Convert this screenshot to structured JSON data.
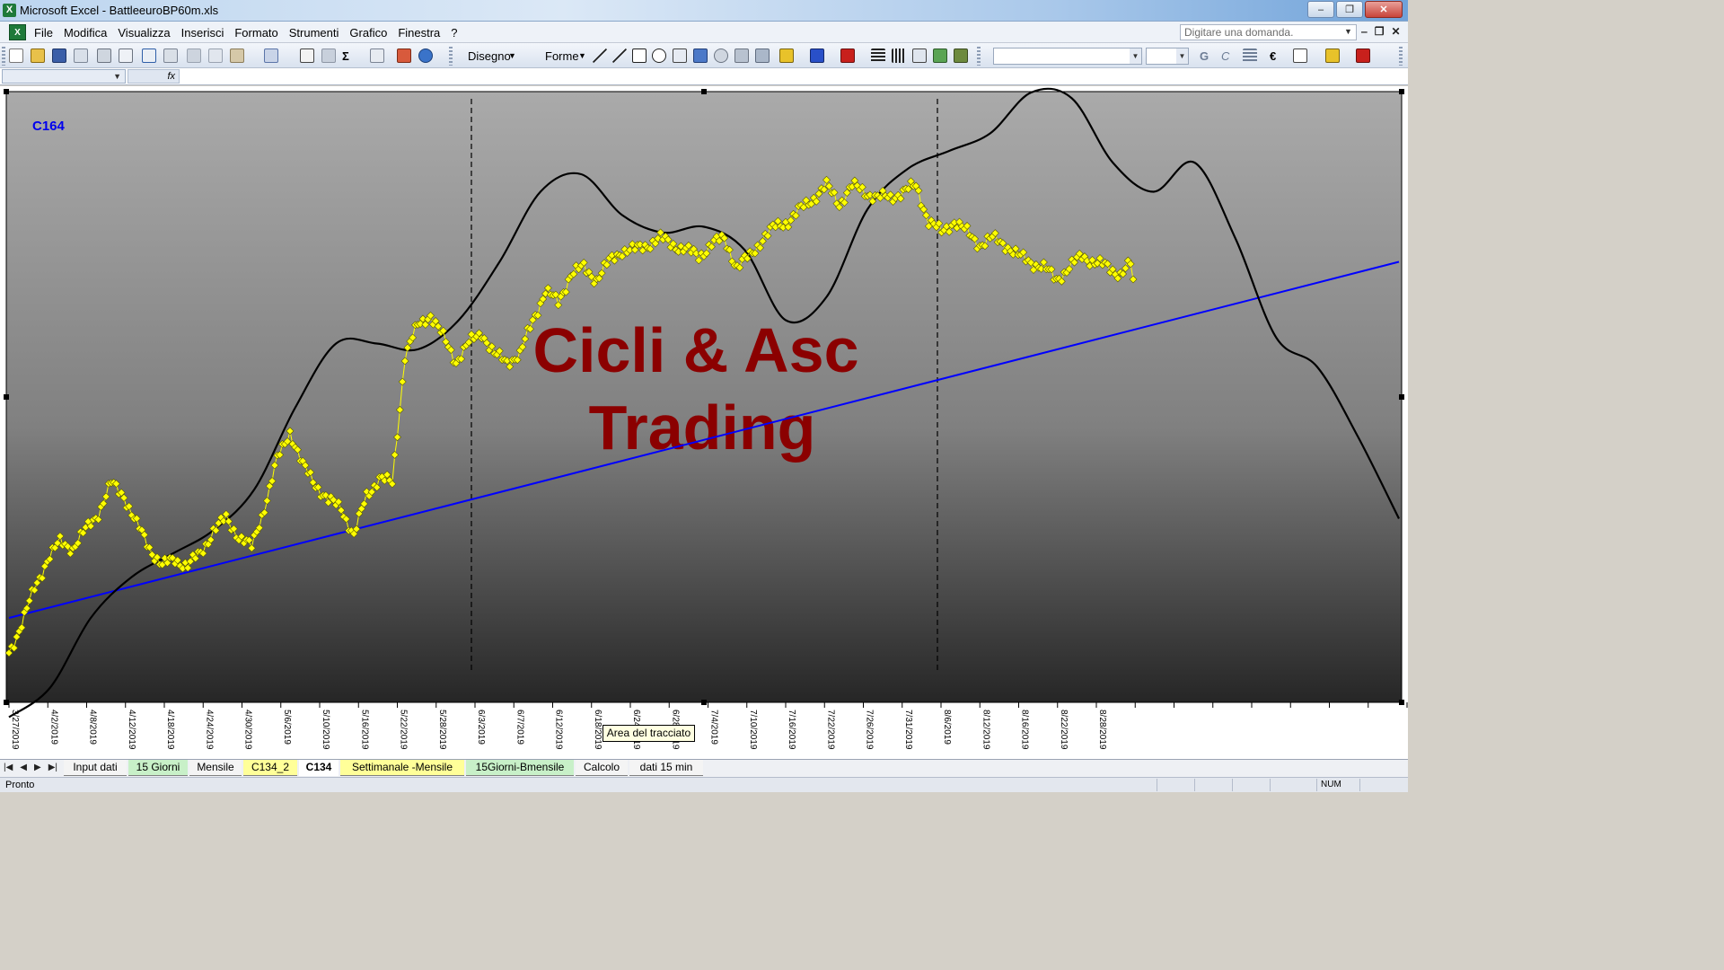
{
  "window": {
    "title": "Microsoft Excel - BattleeuroBP60m.xls",
    "minimize": "‒",
    "restore": "❐",
    "close": "✕"
  },
  "menu": {
    "items": [
      "File",
      "Modifica",
      "Visualizza",
      "Inserisci",
      "Formato",
      "Strumenti",
      "Grafico",
      "Finestra",
      "?"
    ],
    "help_placeholder": "Digitare una domanda.",
    "doc_minimize": "‒",
    "doc_restore": "❐",
    "doc_close": "✕"
  },
  "toolbar": {
    "draw_label": "Disegno",
    "shapes_label": "Forme",
    "sigma": "Σ",
    "euro": "€",
    "bold": "G",
    "italic": "C"
  },
  "formula": {
    "fx": "fx"
  },
  "chart_data": {
    "type": "line",
    "chart_label": "C164",
    "watermark": [
      "Cicli & Asc",
      "Trading"
    ],
    "tooltip": "Area del tracciato",
    "x_ticks": [
      "3/27/2019",
      "4/2/2019",
      "4/8/2019",
      "4/12/2019",
      "4/18/2019",
      "4/24/2019",
      "4/30/2019",
      "5/6/2019",
      "5/10/2019",
      "5/16/2019",
      "5/22/2019",
      "5/28/2019",
      "6/3/2019",
      "6/7/2019",
      "6/12/2019",
      "6/18/2019",
      "6/24/2019",
      "6/28/2019",
      "7/4/2019",
      "7/10/2019",
      "7/16/2019",
      "7/22/2019",
      "7/26/2019",
      "7/31/2019",
      "8/6/2019",
      "8/12/2019",
      "8/16/2019",
      "8/22/2019",
      "8/28/2019"
    ],
    "price_series": {
      "color": "#ffff00",
      "marker": "diamond",
      "values": [
        0.06,
        0.11,
        0.17,
        0.22,
        0.25,
        0.24,
        0.27,
        0.3,
        0.35,
        0.33,
        0.28,
        0.24,
        0.21,
        0.22,
        0.21,
        0.23,
        0.27,
        0.29,
        0.26,
        0.24,
        0.31,
        0.39,
        0.44,
        0.38,
        0.35,
        0.32,
        0.31,
        0.26,
        0.33,
        0.36,
        0.35,
        0.57,
        0.62,
        0.64,
        0.6,
        0.56,
        0.59,
        0.61,
        0.57,
        0.56,
        0.57,
        0.63,
        0.68,
        0.66,
        0.71,
        0.72,
        0.7,
        0.73,
        0.75,
        0.75,
        0.76,
        0.77,
        0.76,
        0.75,
        0.74,
        0.76,
        0.77,
        0.72,
        0.74,
        0.77,
        0.79,
        0.8,
        0.82,
        0.84,
        0.86,
        0.83,
        0.86,
        0.85,
        0.84,
        0.84,
        0.85,
        0.86,
        0.8,
        0.78,
        0.8,
        0.78,
        0.76,
        0.77,
        0.76,
        0.74,
        0.73,
        0.72,
        0.7,
        0.72,
        0.74,
        0.73,
        0.72,
        0.71,
        0.73
      ]
    },
    "cycle_series": {
      "color": "#000000",
      "values": [
        -0.05,
        0.0,
        0.12,
        0.19,
        0.23,
        0.27,
        0.34,
        0.48,
        0.59,
        0.59,
        0.58,
        0.63,
        0.73,
        0.85,
        0.88,
        0.81,
        0.78,
        0.79,
        0.75,
        0.63,
        0.67,
        0.82,
        0.89,
        0.92,
        0.95,
        1.02,
        1.01,
        0.9,
        0.85,
        0.9,
        0.77,
        0.6,
        0.55,
        0.43,
        0.29
      ]
    },
    "trend_series": {
      "color": "#0000ff",
      "values": [
        0.12,
        0.73
      ]
    },
    "cycle_markers": [
      "6/3/2019",
      "8/6/2019"
    ]
  },
  "tabs": [
    "Input dati",
    "15 Giorni",
    "Mensile",
    "C134_2",
    "C134",
    "Settimanale -Mensile",
    "15Giorni-Bmensile",
    "Calcolo",
    "dati 15 min"
  ],
  "status": {
    "ready": "Pronto",
    "num": "NUM"
  }
}
